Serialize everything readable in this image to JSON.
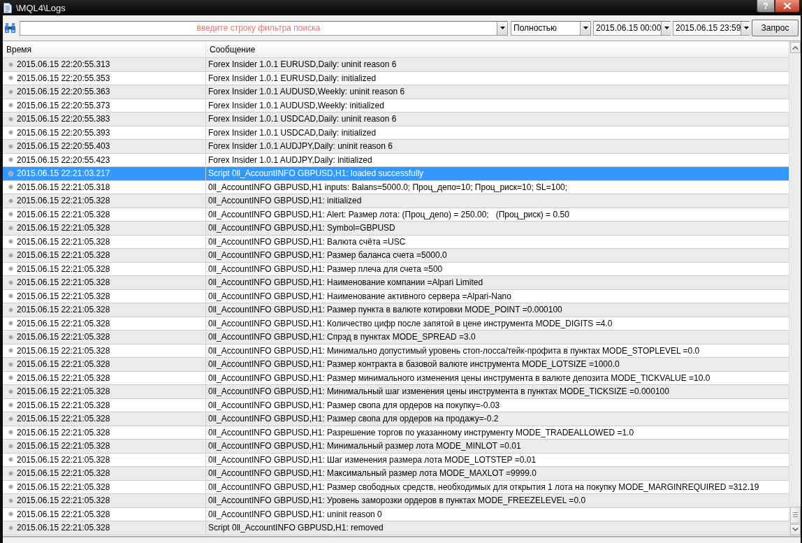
{
  "window": {
    "title": "\\MQL4\\Logs",
    "help_button": "?"
  },
  "toolbar": {
    "filter": {
      "placeholder": "введите строку фильтра поиска"
    },
    "mode": {
      "value": "Полностью"
    },
    "date_from": {
      "value": "2015.06.15 00:00"
    },
    "date_to": {
      "value": "2015.06.15 23:59"
    },
    "query_button": "Запрос"
  },
  "table": {
    "columns": [
      "Время",
      "Сообщение"
    ],
    "rows": [
      {
        "time": "2015.06.15 22:20:55.313",
        "message": "Forex Insider 1.0.1 EURUSD,Daily: uninit reason 6",
        "selected": false
      },
      {
        "time": "2015.06.15 22:20:55.353",
        "message": "Forex Insider 1.0.1 EURUSD,Daily: initialized",
        "selected": false
      },
      {
        "time": "2015.06.15 22:20:55.363",
        "message": "Forex Insider 1.0.1 AUDUSD,Weekly: uninit reason 6",
        "selected": false
      },
      {
        "time": "2015.06.15 22:20:55.373",
        "message": "Forex Insider 1.0.1 AUDUSD,Weekly: initialized",
        "selected": false
      },
      {
        "time": "2015.06.15 22:20:55.383",
        "message": "Forex Insider 1.0.1 USDCAD,Daily: uninit reason 6",
        "selected": false
      },
      {
        "time": "2015.06.15 22:20:55.393",
        "message": "Forex Insider 1.0.1 USDCAD,Daily: initialized",
        "selected": false
      },
      {
        "time": "2015.06.15 22:20:55.403",
        "message": "Forex Insider 1.0.1 AUDJPY,Daily: uninit reason 6",
        "selected": false
      },
      {
        "time": "2015.06.15 22:20:55.423",
        "message": "Forex Insider 1.0.1 AUDJPY,Daily: initialized",
        "selected": false
      },
      {
        "time": "2015.06.15 22:21:03.217",
        "message": "Script 0ll_AccountINFO GBPUSD,H1: loaded successfully",
        "selected": true
      },
      {
        "time": "2015.06.15 22:21:05.318",
        "message": "0ll_AccountINFO GBPUSD,H1 inputs: Balans=5000.0; Проц_депо=10; Проц_риск=10; SL=100;",
        "selected": false
      },
      {
        "time": "2015.06.15 22:21:05.328",
        "message": "0ll_AccountINFO GBPUSD,H1: initialized",
        "selected": false
      },
      {
        "time": "2015.06.15 22:21:05.328",
        "message": "0ll_AccountINFO GBPUSD,H1: Alert: Размер лота: (Проц_депо) = 250.00;   (Проц_риск) = 0.50",
        "selected": false
      },
      {
        "time": "2015.06.15 22:21:05.328",
        "message": "0ll_AccountINFO GBPUSD,H1: Symbol=GBPUSD",
        "selected": false
      },
      {
        "time": "2015.06.15 22:21:05.328",
        "message": "0ll_AccountINFO GBPUSD,H1: Валюта счёта =USC",
        "selected": false
      },
      {
        "time": "2015.06.15 22:21:05.328",
        "message": "0ll_AccountINFO GBPUSD,H1: Размер баланса счета =5000.0",
        "selected": false
      },
      {
        "time": "2015.06.15 22:21:05.328",
        "message": "0ll_AccountINFO GBPUSD,H1: Размер плеча для счета =500",
        "selected": false
      },
      {
        "time": "2015.06.15 22:21:05.328",
        "message": "0ll_AccountINFO GBPUSD,H1: Наименование компании =Alpari Limited",
        "selected": false
      },
      {
        "time": "2015.06.15 22:21:05.328",
        "message": "0ll_AccountINFO GBPUSD,H1: Наименование активного сервера =Alpari-Nano",
        "selected": false
      },
      {
        "time": "2015.06.15 22:21:05.328",
        "message": "0ll_AccountINFO GBPUSD,H1: Размер пункта в валюте котировки MODE_POINT =0.000100",
        "selected": false
      },
      {
        "time": "2015.06.15 22:21:05.328",
        "message": "0ll_AccountINFO GBPUSD,H1: Количество цифр после запятой в цене инструмента MODE_DIGITS =4.0",
        "selected": false
      },
      {
        "time": "2015.06.15 22:21:05.328",
        "message": "0ll_AccountINFO GBPUSD,H1: Спрэд в пунктах MODE_SPREAD =3.0",
        "selected": false
      },
      {
        "time": "2015.06.15 22:21:05.328",
        "message": "0ll_AccountINFO GBPUSD,H1: Минимально допустимый уровень стоп-лосса/тейк-профита в пунктах MODE_STOPLEVEL =0.0",
        "selected": false
      },
      {
        "time": "2015.06.15 22:21:05.328",
        "message": "0ll_AccountINFO GBPUSD,H1: Размер контракта в базовой валюте инструмента MODE_LOTSIZE =1000.0",
        "selected": false
      },
      {
        "time": "2015.06.15 22:21:05.328",
        "message": "0ll_AccountINFO GBPUSD,H1: Размер минимального изменения цены инструмента в валюте депозита MODE_TICKVALUE =10.0",
        "selected": false
      },
      {
        "time": "2015.06.15 22:21:05.328",
        "message": "0ll_AccountINFO GBPUSD,H1: Минимальный шаг изменения цены инструмента в пунктах MODE_TICKSIZE =0.000100",
        "selected": false
      },
      {
        "time": "2015.06.15 22:21:05.328",
        "message": "0ll_AccountINFO GBPUSD,H1: Размер свопа для ордеров на покупку=-0.03",
        "selected": false
      },
      {
        "time": "2015.06.15 22:21:05.328",
        "message": "0ll_AccountINFO GBPUSD,H1: Размер свопа для ордеров на продажу=-0.2",
        "selected": false
      },
      {
        "time": "2015.06.15 22:21:05.328",
        "message": "0ll_AccountINFO GBPUSD,H1: Разрешение торгов по указанному инструменту MODE_TRADEALLOWED =1.0",
        "selected": false
      },
      {
        "time": "2015.06.15 22:21:05.328",
        "message": "0ll_AccountINFO GBPUSD,H1: Минимальный размер лота MODE_MINLOT =0.01",
        "selected": false
      },
      {
        "time": "2015.06.15 22:21:05.328",
        "message": "0ll_AccountINFO GBPUSD,H1: Шаг изменения размера лота MODE_LOTSTEP =0.01",
        "selected": false
      },
      {
        "time": "2015.06.15 22:21:05.328",
        "message": "0ll_AccountINFO GBPUSD,H1: Максимальный размер лота MODE_MAXLOT =9999.0",
        "selected": false
      },
      {
        "time": "2015.06.15 22:21:05.328",
        "message": "0ll_AccountINFO GBPUSD,H1: Размер свободных средств, необходимых для открытия 1 лота на покупку MODE_MARGINREQUIRED =312.19",
        "selected": false
      },
      {
        "time": "2015.06.15 22:21:05.328",
        "message": "0ll_AccountINFO GBPUSD,H1: Уровень заморозки ордеров в пунктах MODE_FREEZELEVEL =0.0",
        "selected": false
      },
      {
        "time": "2015.06.15 22:21:05.328",
        "message": "0ll_AccountINFO GBPUSD,H1: uninit reason 0",
        "selected": false
      },
      {
        "time": "2015.06.15 22:21:05.328",
        "message": "Script 0ll_AccountINFO GBPUSD,H1: removed",
        "selected": false
      }
    ]
  }
}
